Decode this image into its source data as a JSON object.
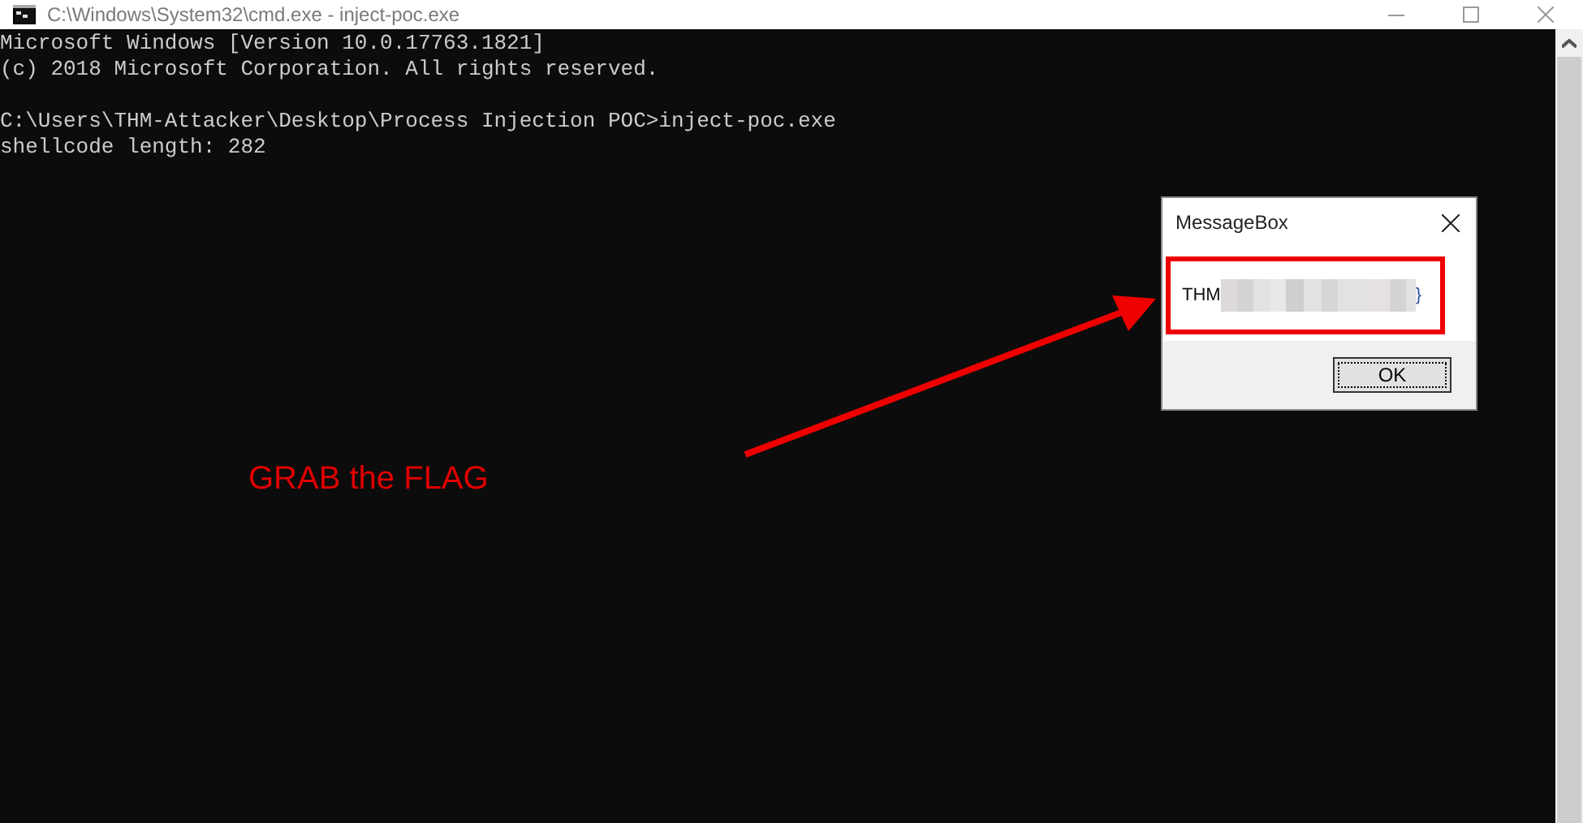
{
  "window": {
    "title": "C:\\Windows\\System32\\cmd.exe - inject-poc.exe"
  },
  "console": {
    "blocks": [
      [
        "Microsoft Windows [Version 10.0.17763.1821]",
        "(c) 2018 Microsoft Corporation. All rights reserved."
      ],
      [
        "C:\\Users\\THM-Attacker\\Desktop\\Process Injection POC>inject-poc.exe",
        "shellcode length: 282"
      ]
    ]
  },
  "message_box": {
    "title": "MessageBox",
    "message_start": "THM",
    "message_end": "}",
    "button": "OK"
  },
  "annotation": {
    "text": "GRAB the FLAG"
  }
}
